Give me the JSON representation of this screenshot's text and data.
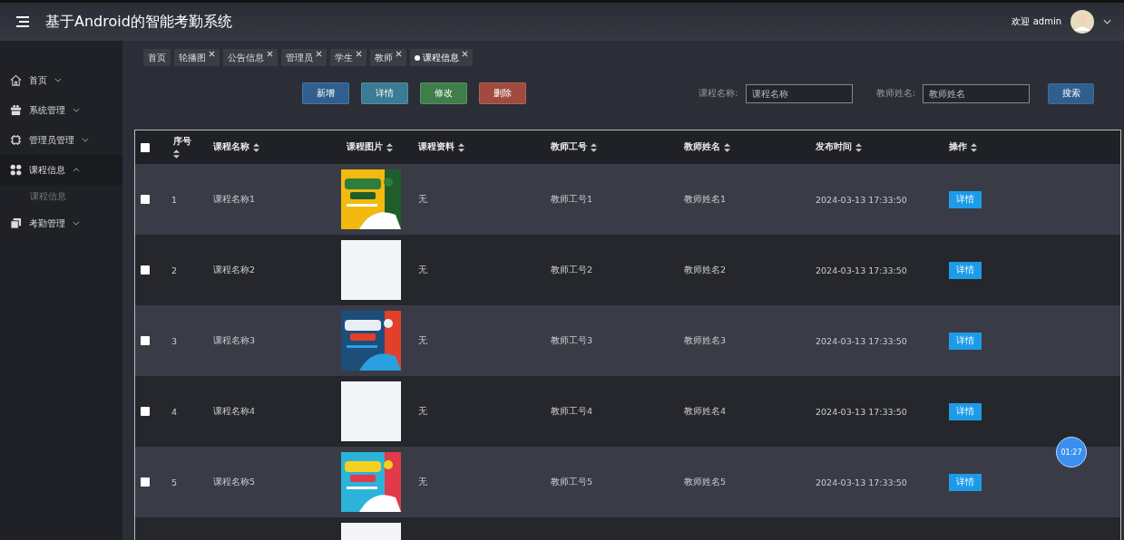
{
  "header": {
    "title": "基于Android的智能考勤系统",
    "welcome": "欢迎 admin"
  },
  "sidebar": {
    "items": [
      {
        "label": "首页",
        "expanded": false
      },
      {
        "label": "系统管理",
        "expanded": false
      },
      {
        "label": "管理员管理",
        "expanded": false
      },
      {
        "label": "课程信息",
        "expanded": true,
        "children": [
          {
            "label": "课程信息"
          }
        ]
      },
      {
        "label": "考勤管理",
        "expanded": false
      }
    ]
  },
  "tabs": [
    {
      "label": "首页",
      "closable": false,
      "selected": false
    },
    {
      "label": "轮播图",
      "closable": true,
      "selected": false
    },
    {
      "label": "公告信息",
      "closable": true,
      "selected": false
    },
    {
      "label": "管理员",
      "closable": true,
      "selected": false
    },
    {
      "label": "学生",
      "closable": true,
      "selected": false
    },
    {
      "label": "教师",
      "closable": true,
      "selected": false
    },
    {
      "label": "课程信息",
      "closable": true,
      "selected": true
    }
  ],
  "actions": [
    {
      "label": "新增",
      "color": "#2f5f8f"
    },
    {
      "label": "详情",
      "color": "#3a7b95"
    },
    {
      "label": "修改",
      "color": "#3f7d4a"
    },
    {
      "label": "删除",
      "color": "#a04a40"
    }
  ],
  "search": {
    "fields": [
      {
        "label": "课程名称:",
        "placeholder": "课程名称"
      },
      {
        "label": "教师姓名:",
        "placeholder": "教师姓名"
      }
    ],
    "button": "搜索"
  },
  "table": {
    "select_all_checked": false,
    "columns": [
      "序号",
      "课程名称",
      "课程图片",
      "课程资料",
      "教师工号",
      "教师姓名",
      "发布时间",
      "操作"
    ],
    "rows": [
      {
        "checked": false,
        "index": "1",
        "name": "课程名称1",
        "docs": "无",
        "teacher_id": "教师工号1",
        "teacher_name": "教师姓名1",
        "time": "2024-03-13 17:33:50",
        "action": "详情"
      },
      {
        "checked": false,
        "index": "2",
        "name": "课程名称2",
        "image": {
          "kind": "blank"
        },
        "docs": "无",
        "teacher_id": "教师工号2",
        "teacher_name": "教师姓名2",
        "time": "2024-03-13 17:33:50",
        "action": "详情"
      },
      {
        "checked": false,
        "index": "3",
        "name": "课程名称3",
        "docs": "无",
        "teacher_id": "教师工号3",
        "teacher_name": "教师姓名3",
        "time": "2024-03-13 17:33:50",
        "action": "详情"
      },
      {
        "checked": false,
        "index": "4",
        "name": "课程名称4",
        "image": {
          "kind": "blank"
        },
        "docs": "无",
        "teacher_id": "教师工号4",
        "teacher_name": "教师姓名4",
        "time": "2024-03-13 17:33:50",
        "action": "详情"
      },
      {
        "checked": false,
        "index": "5",
        "name": "课程名称5",
        "docs": "无",
        "teacher_id": "教师工号5",
        "teacher_name": "教师姓名5",
        "time": "2024-03-13 17:33:50",
        "action": "详情"
      },
      {
        "image": {
          "kind": "blank"
        }
      }
    ]
  },
  "timer": "01:27"
}
